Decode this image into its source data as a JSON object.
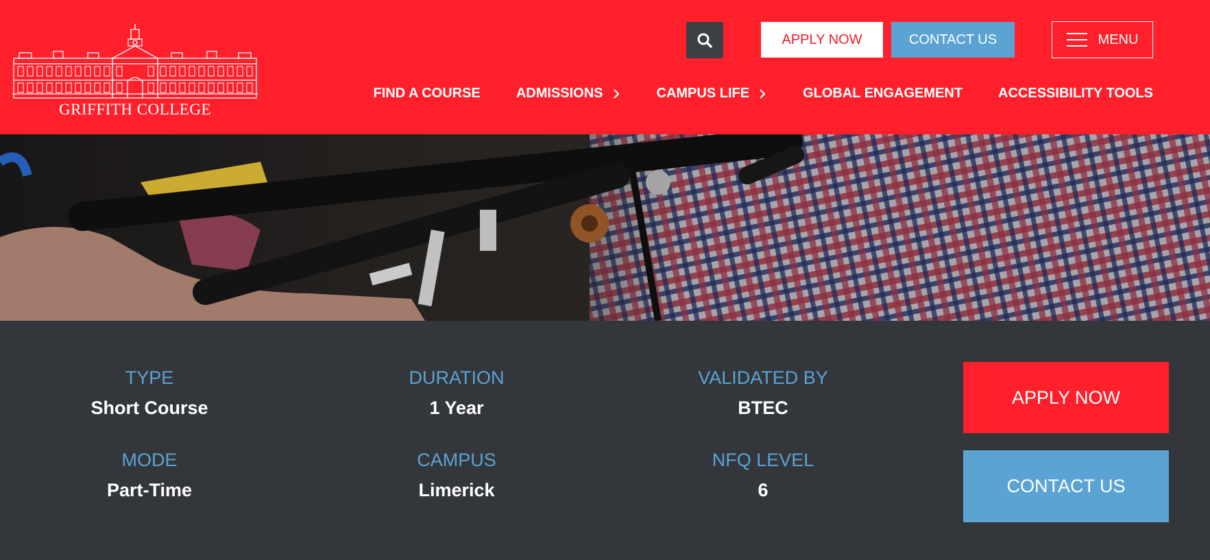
{
  "brand": {
    "name": "GRIFFITH COLLEGE"
  },
  "colors": {
    "header_red": "#ff202c",
    "accent_blue": "#5ba3d3",
    "panel_dark": "#33373b",
    "search_dark": "#3c4044"
  },
  "header": {
    "search_icon": "search-icon",
    "apply_label": "APPLY NOW",
    "contact_label": "CONTACT US",
    "menu_label": "MENU",
    "menu_icon": "hamburger-icon"
  },
  "nav": [
    {
      "label": "FIND A COURSE"
    },
    {
      "label": "ADMISSIONS",
      "icon": "chevron-right-icon"
    },
    {
      "label": "CAMPUS LIFE",
      "icon": "chevron-right-icon"
    },
    {
      "label": "GLOBAL ENGAGEMENT"
    },
    {
      "label": "ACCESSIBILITY TOOLS"
    }
  ],
  "course_info": [
    {
      "label": "TYPE",
      "value": "Short Course"
    },
    {
      "label": "DURATION",
      "value": "1 Year"
    },
    {
      "label": "VALIDATED BY",
      "value": "BTEC"
    },
    {
      "label": "MODE",
      "value": "Part-Time"
    },
    {
      "label": "CAMPUS",
      "value": "Limerick"
    },
    {
      "label": "NFQ LEVEL",
      "value": "6"
    }
  ],
  "cta": {
    "apply_label": "APPLY NOW",
    "contact_label": "CONTACT US"
  }
}
